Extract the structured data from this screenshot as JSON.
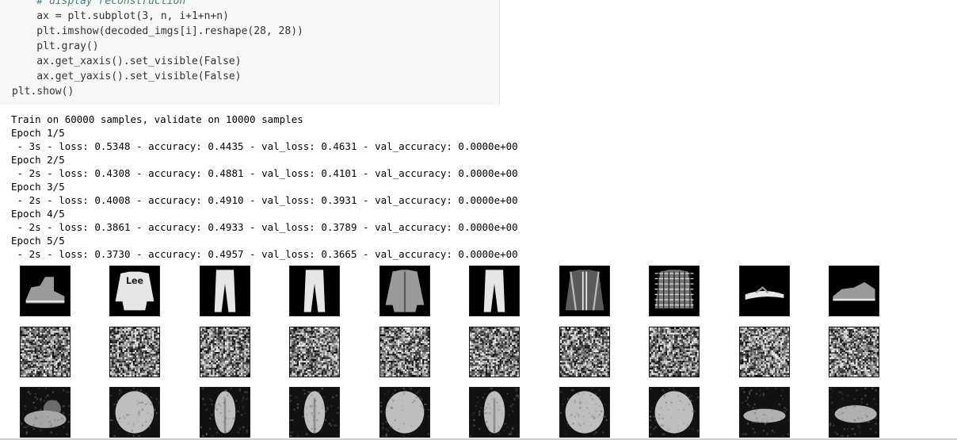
{
  "code_cell": {
    "lines": [
      "    # display reconstruction",
      "    ax = plt.subplot(3, n, i+1+n+n)",
      "    plt.imshow(decoded_imgs[i].reshape(28, 28))",
      "    plt.gray()",
      "    ax.get_xaxis().set_visible(False)",
      "    ax.get_yaxis().set_visible(False)",
      "plt.show()"
    ]
  },
  "output": {
    "lines": [
      "Train on 60000 samples, validate on 10000 samples",
      "Epoch 1/5",
      " - 3s - loss: 0.5348 - accuracy: 0.4435 - val_loss: 0.4631 - val_accuracy: 0.0000e+00",
      "Epoch 2/5",
      " - 2s - loss: 0.4308 - accuracy: 0.4881 - val_loss: 0.4101 - val_accuracy: 0.0000e+00",
      "Epoch 3/5",
      " - 2s - loss: 0.4008 - accuracy: 0.4910 - val_loss: 0.3931 - val_accuracy: 0.0000e+00",
      "Epoch 4/5",
      " - 2s - loss: 0.3861 - accuracy: 0.4933 - val_loss: 0.3789 - val_accuracy: 0.0000e+00",
      "Epoch 5/5",
      " - 2s - loss: 0.3730 - accuracy: 0.4957 - val_loss: 0.3665 - val_accuracy: 0.0000e+00"
    ]
  },
  "figure": {
    "rows": [
      {
        "name": "original",
        "items": [
          "ankle-boot",
          "lee-sweatshirt",
          "trouser",
          "trouser",
          "shirt",
          "trouser",
          "jacket",
          "checked-shirt",
          "sandal",
          "sneaker"
        ]
      },
      {
        "name": "noisy",
        "items": [
          "noise",
          "noise",
          "noise",
          "noise",
          "noise",
          "noise",
          "noise",
          "noise",
          "noise",
          "noise"
        ]
      },
      {
        "name": "reconstruction",
        "items": [
          "blurry-boot",
          "blurry-top",
          "blurry-trouser",
          "blurry-trouser",
          "blurry-top",
          "blurry-trouser",
          "blurry-top",
          "blurry-top",
          "blurry-sandal",
          "blurry-sneaker"
        ]
      }
    ],
    "thumb_label_text": "Lee"
  },
  "colors": {
    "code_bg": "#f7f7f7",
    "comment": "#408080",
    "number": "#008800",
    "keyword": "#0055aa"
  }
}
